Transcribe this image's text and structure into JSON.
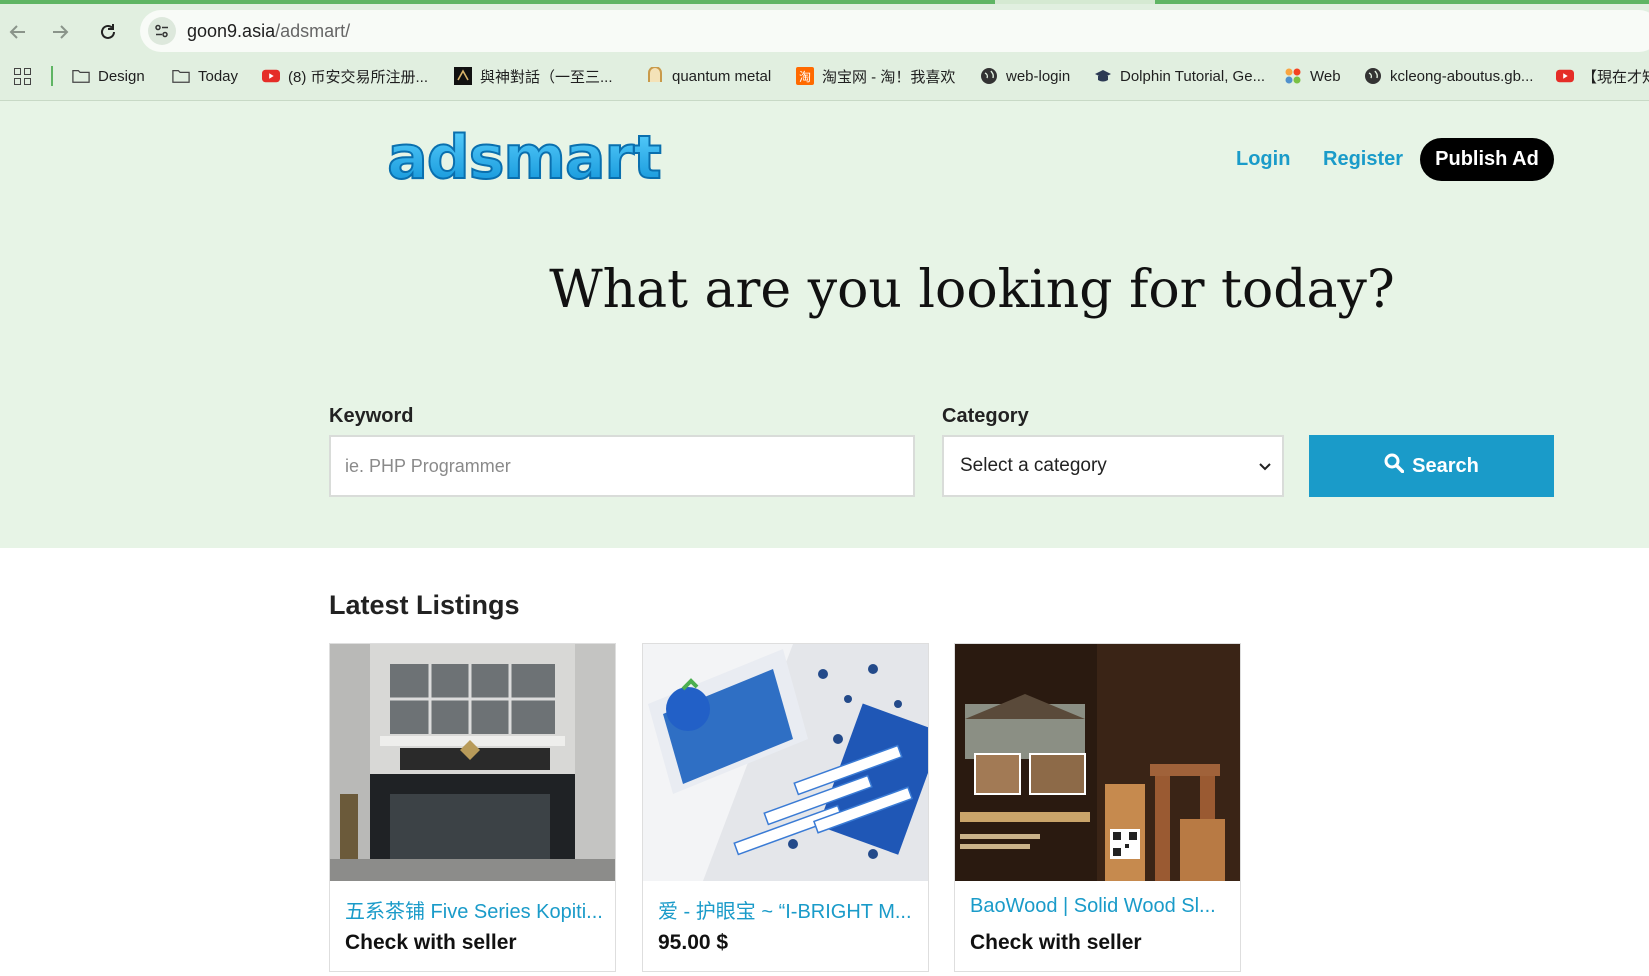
{
  "browser": {
    "url_host": "goon9.asia",
    "url_path": "/adsmart/",
    "bookmarks": [
      {
        "label": "Design",
        "icon": "folder-icon"
      },
      {
        "label": "Today",
        "icon": "folder-icon"
      },
      {
        "label": "(8) 币安交易所注册...",
        "icon": "youtube-icon"
      },
      {
        "label": "與神對話（一至三...",
        "icon": "book-icon"
      },
      {
        "label": "quantum metal",
        "icon": "quantum-icon"
      },
      {
        "label": "淘宝网 - 淘！我喜欢",
        "icon": "taobao-icon"
      },
      {
        "label": "web-login",
        "icon": "globe-icon"
      },
      {
        "label": "Dolphin Tutorial, Ge...",
        "icon": "graduation-cap-icon"
      },
      {
        "label": "Web",
        "icon": "joomla-icon"
      },
      {
        "label": "kcleong-aboutus.gb...",
        "icon": "globe-icon"
      },
      {
        "label": "【現在才知",
        "icon": "youtube-icon"
      }
    ]
  },
  "site": {
    "logo_text": "adsmart",
    "nav": {
      "login": "Login",
      "register": "Register",
      "publish": "Publish Ad"
    },
    "headline": "What are you looking for today?",
    "search": {
      "keyword_label": "Keyword",
      "keyword_placeholder": "ie. PHP Programmer",
      "keyword_value": "",
      "category_label": "Category",
      "category_selected": "Select a category",
      "button": "Search"
    },
    "latest_title": "Latest Listings",
    "listings": [
      {
        "title": "五系茶铺 Five Series Kopiti...",
        "price": "Check with seller"
      },
      {
        "title": "爱 - 护眼宝 ~ “I-BRIGHT M...",
        "price": "95.00 $"
      },
      {
        "title": "BaoWood | Solid Wood Sl...",
        "price": "Check with seller"
      }
    ],
    "colors": {
      "accent": "#1a9bc9",
      "hero_bg": "#e7f4e6",
      "publish_bg": "#000000"
    }
  }
}
